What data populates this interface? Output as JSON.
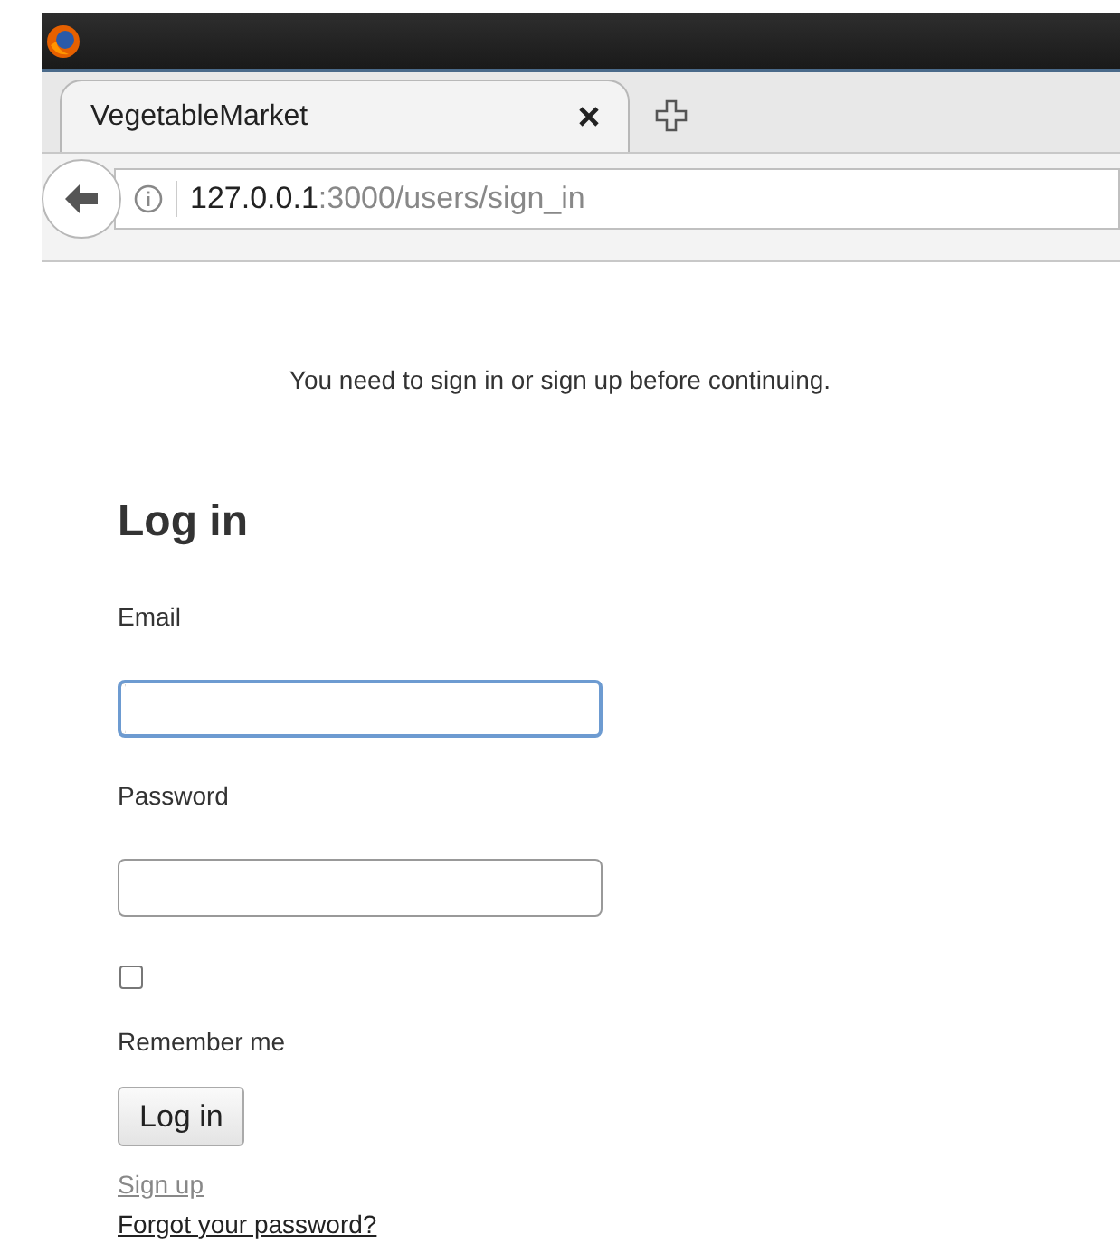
{
  "browser": {
    "tabs": [
      {
        "title": "VegetableMarket",
        "selected": true
      }
    ],
    "address": {
      "host": "127.0.0.1",
      "rest": ":3000/users/sign_in"
    }
  },
  "notice": "You need to sign in or sign up before continuing.",
  "heading": "Log in",
  "fields": [
    {
      "label": "Email",
      "focused": true
    },
    {
      "label": "Password",
      "focused": false
    }
  ],
  "remember": {
    "label": "Remember me",
    "checked": false
  },
  "submit": "Log in",
  "links": [
    {
      "text": "Sign up",
      "visited": true
    },
    {
      "text": "Forgot your password?",
      "visited": false
    }
  ]
}
